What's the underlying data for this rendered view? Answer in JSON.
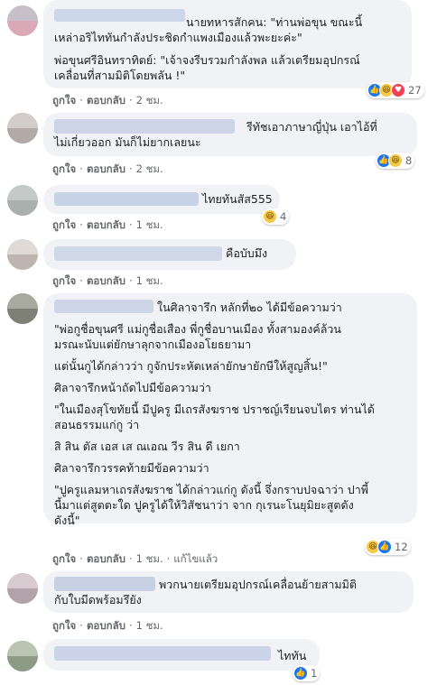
{
  "comments": [
    {
      "paragraphs": [
        [
          "นายทหารสักคน: \"ท่านพ่อขุน ขณะนี้",
          "เหล่าอริไททันกำลังประชิดกำแพงเมืองแล้วพะยะค่ะ\""
        ],
        [
          "พ่อขุนศรีอินทราทิตย์: \"เจ้าจงรีบรวมกำลังพล แล้วเตรียมอุปกรณ์",
          "เคลื่อนที่สามมิติโดยพลัน !\""
        ]
      ],
      "actions": {
        "like": "ถูกใจ",
        "reply": "ตอบกลับ",
        "time": "2 ชม."
      },
      "reactions": {
        "icons": [
          "like-icon",
          "haha-icon",
          "love-icon"
        ],
        "count": "27"
      }
    },
    {
      "paragraphs": [
        [
          "รีทัชเอาภาษาญี่ปุ่น เอาไอ้ที่",
          "ไม่เกี่ยวออก มันก็ไม่ยากเลยนะ"
        ]
      ],
      "actions": {
        "like": "ถูกใจ",
        "reply": "ตอบกลับ",
        "time": "2 ชม."
      },
      "reactions": {
        "icons": [
          "like-icon",
          "haha-icon"
        ],
        "count": "8"
      }
    },
    {
      "paragraphs": [
        [
          "ไทยทันสัส555"
        ]
      ],
      "actions": {
        "like": "ถูกใจ",
        "reply": "ตอบกลับ",
        "time": "1 ชม."
      },
      "reactions": {
        "icons": [
          "haha-icon"
        ],
        "count": "4"
      }
    },
    {
      "paragraphs": [
        [
          "คือบับมึง"
        ]
      ],
      "actions": {
        "like": "ถูกใจ",
        "reply": "ตอบกลับ",
        "time": "1 ชม."
      }
    },
    {
      "paragraphs": [
        [
          "ในศิลาจารึก หลักที่๒๐ ได้มีข้อความว่า"
        ],
        [
          "\"พ่อกูชื่อขุนศรี แม่กูชื่อเสือง พี่กูชื่อบานเมือง ทั้งสามองค์ล้วน",
          "มรณะนับแต่ยักษาลุกจากเมืองอโยธยามา"
        ],
        [
          "แต่นั้นกูได้กล่าวว่า กูจักประหัตเหล่ายักษายักษีให้สูญสิ้น!\""
        ],
        [
          "ศิลาจารึกหน้าถัดไปมีข้อความว่า"
        ],
        [
          "\"ในเมืองสุโขทัยนี้ มีปูครู มีเถรสังฆราช ปราชญ์เรียนจบไตร ท่านได้",
          "สอนธรรมแก่กู ว่า"
        ],
        [
          "สิ สิน ตัส เอส เส ณเอณ วีร สิน ดี เยกา"
        ],
        [
          "ศิลาจารึกวรรคท้ายมีข้อความว่า"
        ],
        [
          "\"ปูครูแลมหาเถรสังฆราช ได้กล่าวแก่กู ดังนี้ จึ่งกราบปจฉาว่า ปาพี้",
          "นี้มาแต่สูตตะใด ปูครูได้ให้วิสัชนาว่า จาก กุเรนะโนยุมิยะสูตดัง",
          "ดังนี้\""
        ]
      ],
      "actions": {
        "like": "ถูกใจ",
        "reply": "ตอบกลับ",
        "time": "1 ชม.",
        "edited": "แก้ไขแล้ว"
      },
      "reactions": {
        "icons": [
          "haha-icon",
          "like-icon"
        ],
        "count": "12"
      }
    },
    {
      "paragraphs": [
        [
          "พวกนายเตรียมอุปกรณ์เคลื่อนย้ายสามมิติ",
          "กับใบมีดพร้อมรึยัง"
        ]
      ],
      "actions": {
        "like": "ถูกใจ",
        "reply": "ตอบกลับ",
        "time": "1 ชม."
      }
    },
    {
      "paragraphs": [
        [
          "ไททัน"
        ]
      ],
      "reactions": {
        "icons": [
          "like-icon"
        ],
        "count": "1"
      }
    }
  ],
  "colors": {
    "bubble": "#f0f2f5",
    "meta": "#65676b",
    "like": "#1877f2",
    "haha": "#f7c948",
    "love": "#f33e58"
  }
}
